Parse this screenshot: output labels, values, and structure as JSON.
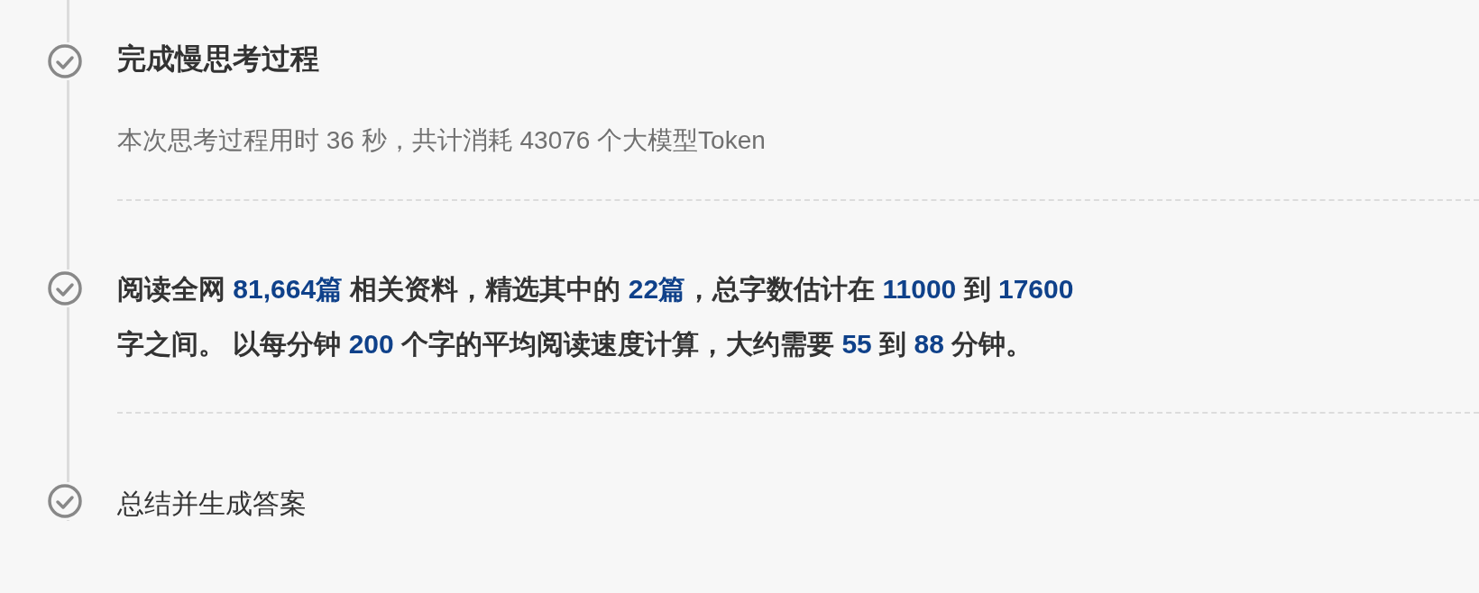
{
  "steps": [
    {
      "kind": "heading",
      "title": "完成慢思考过程",
      "note": "本次思考过程用时 36 秒，共计消耗 43076 个大模型Token"
    },
    {
      "kind": "summary",
      "text": "阅读全网 **81,664篇** 相关资料，精选其中的 **22篇**，总字数估计在 **11000** 到 **17600** 字之间。 以每分钟 **200** 个字的平均阅读速度计算，大约需要 **55** 到 **88** 分钟。"
    },
    {
      "kind": "plain",
      "title": "总结并生成答案"
    }
  ]
}
